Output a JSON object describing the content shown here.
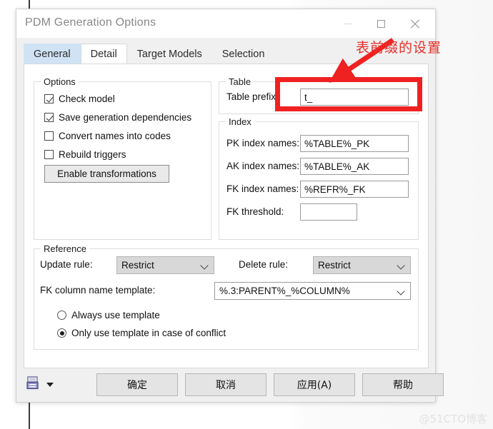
{
  "window": {
    "title": "PDM Generation Options",
    "controls": {
      "minimize": "minimize-icon",
      "maximize": "maximize-icon",
      "close": "close-icon"
    }
  },
  "tabs": [
    {
      "label": "General",
      "state": "hovered"
    },
    {
      "label": "Detail",
      "state": "active"
    },
    {
      "label": "Target Models",
      "state": "normal"
    },
    {
      "label": "Selection",
      "state": "normal"
    }
  ],
  "options_group": {
    "title": "Options",
    "checkboxes": [
      {
        "label": "Check model",
        "checked": true
      },
      {
        "label": "Save generation dependencies",
        "checked": true
      },
      {
        "label": "Convert names into codes",
        "checked": false
      },
      {
        "label": "Rebuild triggers",
        "checked": false
      }
    ],
    "button": "Enable transformations"
  },
  "table_group": {
    "title": "Table",
    "prefix_label": "Table prefix:",
    "prefix_value": "t_"
  },
  "index_group": {
    "title": "Index",
    "fields": [
      {
        "label": "PK index names:",
        "value": "%TABLE%_PK"
      },
      {
        "label": "AK index names:",
        "value": "%TABLE%_AK"
      },
      {
        "label": "FK index names:",
        "value": "%REFR%_FK"
      },
      {
        "label": "FK threshold:",
        "value": ""
      }
    ]
  },
  "reference_group": {
    "title": "Reference",
    "update_rule_label": "Update rule:",
    "update_rule_value": "Restrict",
    "delete_rule_label": "Delete rule:",
    "delete_rule_value": "Restrict",
    "fk_template_label": "FK column name template:",
    "fk_template_value": "%.3:PARENT%_%COLUMN%",
    "radios": [
      {
        "label": "Always use template",
        "selected": false
      },
      {
        "label": "Only use template in case of conflict",
        "selected": true
      }
    ]
  },
  "footer": {
    "print_icon": "print-icon",
    "dropdown_icon": "chevron-down-icon",
    "buttons": [
      {
        "label": "确定"
      },
      {
        "label": "取消"
      },
      {
        "label": "应用(A)"
      },
      {
        "label": "帮助"
      }
    ]
  },
  "annotation": {
    "text": "表前缀的设置",
    "color": "#ef2121"
  },
  "watermark": "@51CTO博客"
}
